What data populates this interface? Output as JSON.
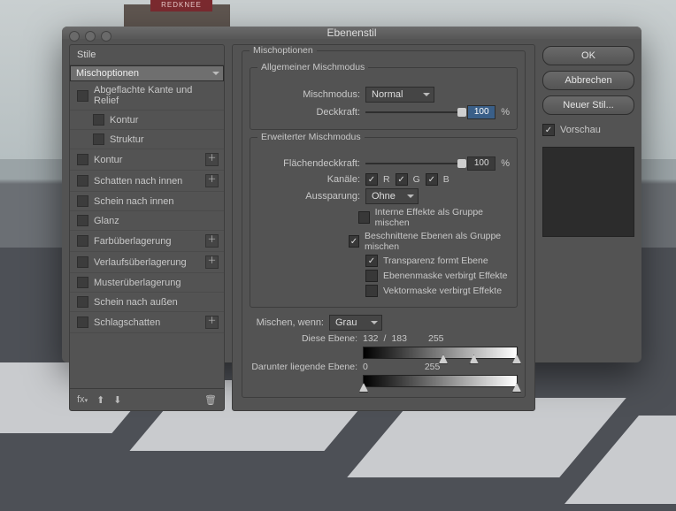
{
  "window": {
    "title": "Ebenenstil"
  },
  "bg_sign": "REDKNEE",
  "styles_header": "Stile",
  "styles": [
    {
      "label": "Mischoptionen",
      "checked": null,
      "sub": false,
      "sel": true,
      "plus": false
    },
    {
      "label": "Abgeflachte Kante und Relief",
      "checked": false,
      "sub": false,
      "sel": false,
      "plus": false
    },
    {
      "label": "Kontur",
      "checked": false,
      "sub": true,
      "sel": false,
      "plus": false
    },
    {
      "label": "Struktur",
      "checked": false,
      "sub": true,
      "sel": false,
      "plus": false
    },
    {
      "label": "Kontur",
      "checked": false,
      "sub": false,
      "sel": false,
      "plus": true
    },
    {
      "label": "Schatten nach innen",
      "checked": false,
      "sub": false,
      "sel": false,
      "plus": true
    },
    {
      "label": "Schein nach innen",
      "checked": false,
      "sub": false,
      "sel": false,
      "plus": false
    },
    {
      "label": "Glanz",
      "checked": false,
      "sub": false,
      "sel": false,
      "plus": false
    },
    {
      "label": "Farbüberlagerung",
      "checked": false,
      "sub": false,
      "sel": false,
      "plus": true
    },
    {
      "label": "Verlaufsüberlagerung",
      "checked": false,
      "sub": false,
      "sel": false,
      "plus": true
    },
    {
      "label": "Musterüberlagerung",
      "checked": false,
      "sub": false,
      "sel": false,
      "plus": false
    },
    {
      "label": "Schein nach außen",
      "checked": false,
      "sub": false,
      "sel": false,
      "plus": false
    },
    {
      "label": "Schlagschatten",
      "checked": false,
      "sub": false,
      "sel": false,
      "plus": true
    }
  ],
  "center": {
    "title": "Mischoptionen",
    "group_general": "Allgemeiner Mischmodus",
    "blendmode_label": "Mischmodus:",
    "blendmode_value": "Normal",
    "opacity_label": "Deckkraft:",
    "opacity_value": "100",
    "pct": "%",
    "group_advanced": "Erweiterter Mischmodus",
    "fillopacity_label": "Flächendeckkraft:",
    "fillopacity_value": "100",
    "channels_label": "Kanäle:",
    "ch_r": "R",
    "ch_g": "G",
    "ch_b": "B",
    "knockout_label": "Aussparung:",
    "knockout_value": "Ohne",
    "cb1": "Interne Effekte als Gruppe mischen",
    "cb2": "Beschnittene Ebenen als Gruppe mischen",
    "cb3": "Transparenz formt Ebene",
    "cb4": "Ebenenmaske verbirgt Effekte",
    "cb5": "Vektormaske verbirgt Effekte",
    "blendif_label": "Mischen, wenn:",
    "blendif_value": "Grau",
    "thislayer_label": "Diese Ebene:",
    "thislayer_lo": "132",
    "thislayer_mid": "183",
    "thislayer_hi": "255",
    "sep": "/",
    "under_label": "Darunter liegende Ebene:",
    "under_lo": "0",
    "under_hi": "255"
  },
  "buttons": {
    "ok": "OK",
    "cancel": "Abbrechen",
    "newstyle": "Neuer Stil...",
    "preview": "Vorschau"
  }
}
